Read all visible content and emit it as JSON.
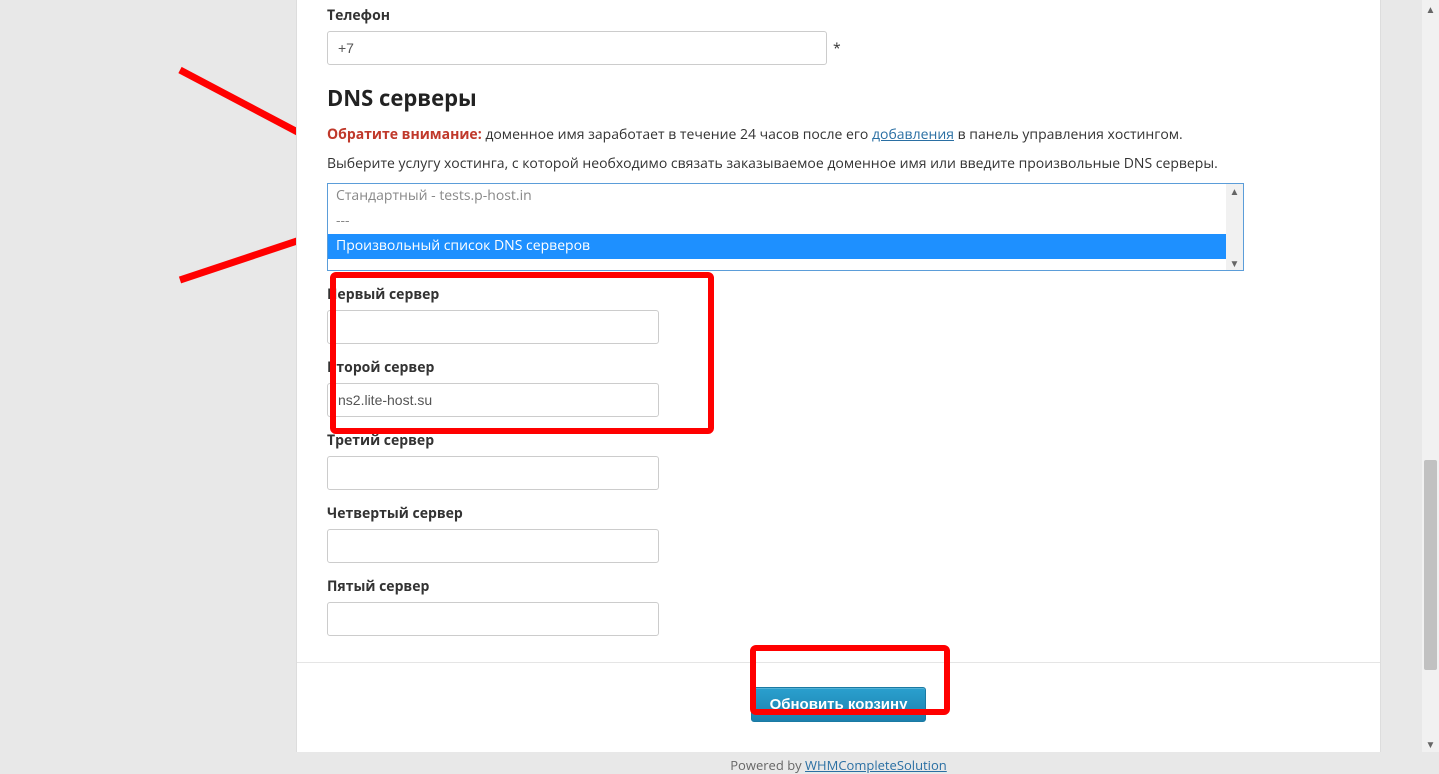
{
  "phone": {
    "label": "Телефон",
    "value": "+7",
    "asterisk": "*"
  },
  "dns": {
    "title": "DNS серверы",
    "notice_lead": "Обратите внимание:",
    "notice_text_before": " доменное имя заработает в течение 24 часов после его ",
    "notice_link": "добавления",
    "notice_text_after": " в панель управления хостингом.",
    "help": "Выберите услугу хостинга, с которой необходимо связать заказываемое доменное имя или введите произвольные DNS серверы.",
    "options": {
      "opt1": "Стандартный - tests.p-host.in",
      "sep": "---",
      "opt2": "Произвольный список DNS серверов"
    }
  },
  "servers": {
    "s1": {
      "label": "Первый сервер",
      "value": ""
    },
    "s2": {
      "label": "Второй сервер",
      "value": "ns2.lite-host.su"
    },
    "s3": {
      "label": "Третий сервер",
      "value": ""
    },
    "s4": {
      "label": "Четвертый сервер",
      "value": ""
    },
    "s5": {
      "label": "Пятый сервер",
      "value": ""
    }
  },
  "actions": {
    "update_cart": "Обновить корзину"
  },
  "footer": {
    "powered_by": "Powered by ",
    "link": "WHMCompleteSolution"
  }
}
